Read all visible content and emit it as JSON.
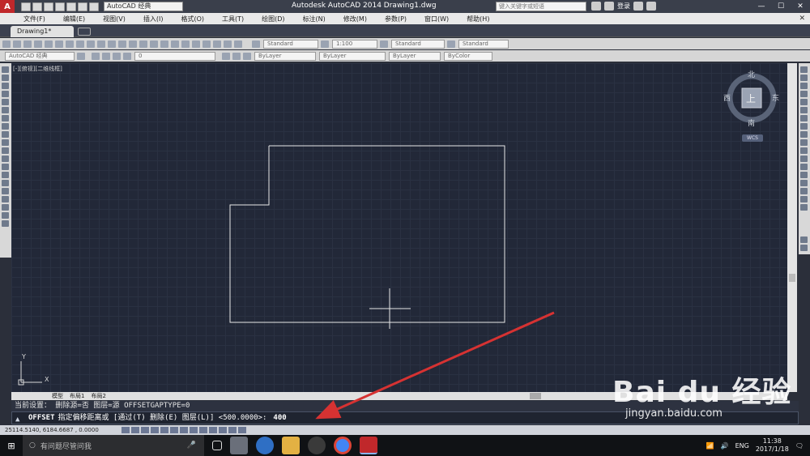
{
  "titlebar": {
    "app_letter": "A",
    "workspace": "AutoCAD 经典",
    "title": "Autodesk AutoCAD 2014    Drawing1.dwg",
    "search_placeholder": "键入关键字或短语",
    "login": "登录",
    "help": "?",
    "minimize": "—",
    "maximize": "☐",
    "close": "✕"
  },
  "menu": {
    "items": [
      "文件(F)",
      "编辑(E)",
      "视图(V)",
      "插入(I)",
      "格式(O)",
      "工具(T)",
      "绘图(D)",
      "标注(N)",
      "修改(M)",
      "参数(P)",
      "窗口(W)",
      "帮助(H)"
    ],
    "close": "✕"
  },
  "tabs": {
    "active": "Drawing1*"
  },
  "toolbar1": {
    "text_style": "Standard",
    "scale": "1:100",
    "dim_style": "Standard",
    "table_style": "Standard"
  },
  "toolbar2": {
    "workspace": "AutoCAD 经典",
    "layer": "0",
    "color": "ByLayer",
    "linetype": "ByLayer",
    "lineweight": "ByLayer",
    "plotstyle": "ByColor"
  },
  "canvas": {
    "viewport_label": "[-][俯视][二维线框]",
    "colors": {
      "background": "#222838",
      "line": "#e8e8e8"
    }
  },
  "viewcube": {
    "north": "北",
    "south": "南",
    "east": "东",
    "west": "西",
    "top": "上",
    "wcs": "WCS"
  },
  "ucs": {
    "x": "X",
    "y": "Y"
  },
  "layout_tabs": [
    "模型",
    "布局1",
    "布局2"
  ],
  "command": {
    "history": "当前设置：   删除源=否    图层=源    OFFSETGAPTYPE=0",
    "name": "OFFSET",
    "prompt": "指定偏移距离或 [通过(T) 删除(E) 图层(L)] <500.0000>:",
    "value": "400"
  },
  "status": {
    "coords": "25114.5140,  6184.6687 , 0.0000"
  },
  "taskbar": {
    "search": "有问题尽管问我",
    "lang": "ENG",
    "time": "11:38",
    "date": "2017/1/18"
  },
  "watermark": {
    "logo": "Bai du 经验",
    "url": "jingyan.baidu.com"
  },
  "annotation": {
    "arrow_color": "#d63232"
  }
}
